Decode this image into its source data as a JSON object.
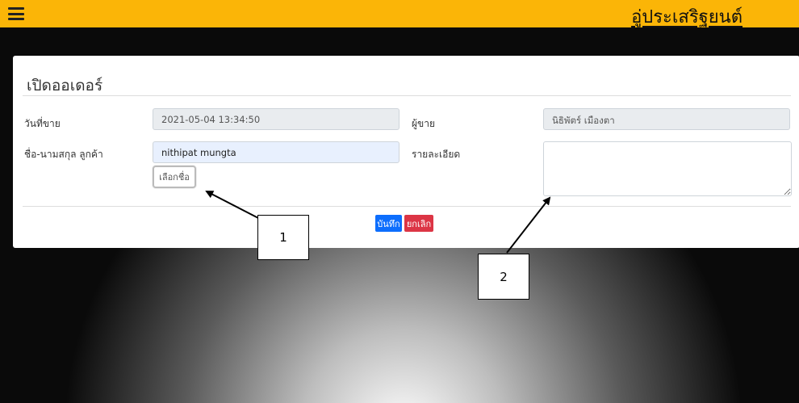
{
  "header": {
    "menu_icon": "hamburger-menu-icon",
    "brand": "อู่ประเสริฐยนต์",
    "bg_color": "#fbb507"
  },
  "form": {
    "title": "เปิดออเดอร์",
    "sale_date_label": "วันที่ขาย",
    "sale_date_value": "2021-05-04 13:34:50",
    "seller_label": "ผู้ขาย",
    "seller_value": "นิธิพัตร์ เมืองตา",
    "customer_label": "ชื่อ-นามสกุล ลูกค้า",
    "customer_value": "nithipat mungta",
    "pick_name_label": "เลือกชื่อ",
    "details_label": "รายละเอียด",
    "details_value": ""
  },
  "actions": {
    "save_label": "บันทึก",
    "cancel_label": "ยกเลิก",
    "save_color": "#0d6efd",
    "cancel_color": "#dc3545"
  },
  "callouts": {
    "one": "1",
    "two": "2"
  }
}
